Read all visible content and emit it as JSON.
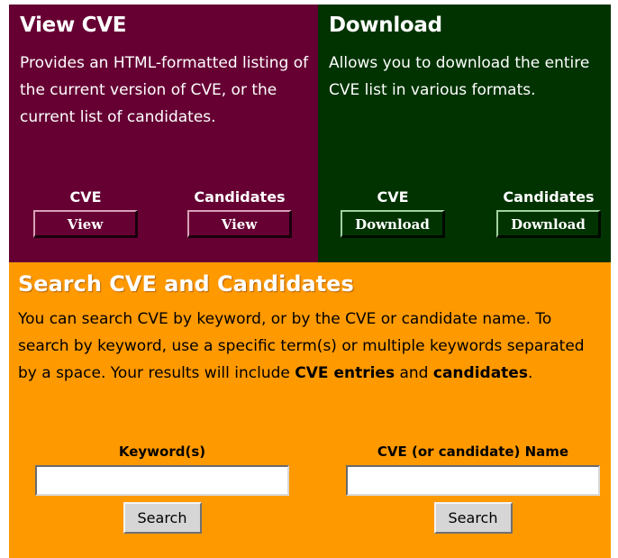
{
  "view": {
    "title": "View CVE",
    "description": "Provides an HTML-formatted listing of the current version of CVE, or the current list of candidates.",
    "cve_label": "CVE",
    "cve_button": "View",
    "candidates_label": "Candidates",
    "candidates_button": "View"
  },
  "download": {
    "title": "Download",
    "description": "Allows you to download the entire CVE list in various formats.",
    "cve_label": "CVE",
    "cve_button": "Download",
    "candidates_label": "Candidates",
    "candidates_button": "Download"
  },
  "search": {
    "title": "Search CVE and Candidates",
    "description_plain": "You can search CVE by keyword, or by the CVE or candidate name. To search by keyword, use a specific term(s) or multiple keywords separated by a space. Your results will include ",
    "description_bold1": "CVE entries",
    "description_and": " and ",
    "description_bold2": "candidates",
    "description_end": ".",
    "keyword": {
      "label": "Keyword(s)",
      "value": "",
      "button": "Search"
    },
    "name": {
      "label": "CVE (or candidate) Name",
      "value": "",
      "button": "Search"
    }
  },
  "colors": {
    "view_bg": "#660033",
    "download_bg": "#003300",
    "search_bg": "#ff9900"
  }
}
